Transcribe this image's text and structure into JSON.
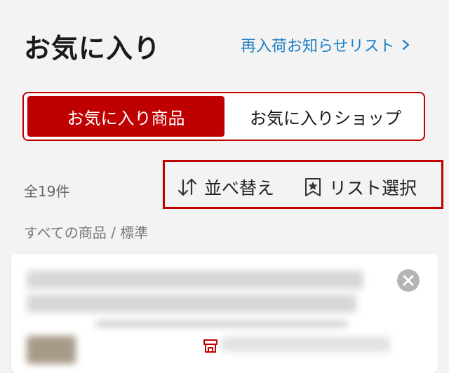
{
  "header": {
    "title": "お気に入り",
    "restock_link": "再入荷お知らせリスト",
    "restock_chevron_icon": "chevron-right-icon"
  },
  "tabs": [
    {
      "label": "お気に入り商品",
      "active": true
    },
    {
      "label": "お気に入りショップ",
      "active": false
    }
  ],
  "summary": {
    "count": "全19件",
    "sort_label": "並べ替え",
    "sort_icon": "sort-arrows-icon",
    "list_select_label": "リスト選択",
    "list_select_icon": "bookmark-star-icon"
  },
  "filter": {
    "label": "すべての商品 / 標準"
  },
  "item_card": {
    "close_icon": "close-icon",
    "shop_icon": "shop-icon"
  },
  "colors": {
    "accent": "#bf0000",
    "link": "#1d7fc4",
    "background": "#f3f3f3"
  }
}
